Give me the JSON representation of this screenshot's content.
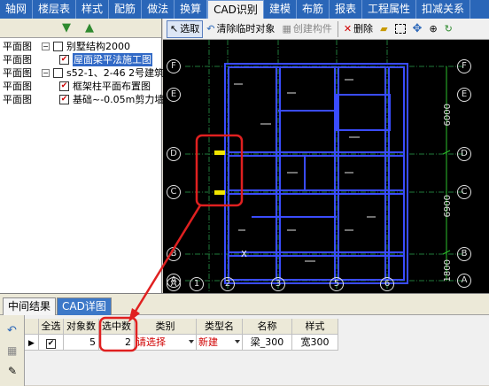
{
  "top_tabs": [
    "轴网",
    "楼层表",
    "样式",
    "配筋",
    "做法",
    "换算",
    "CAD识别",
    "建模",
    "布筋",
    "报表",
    "工程属性",
    "扣减关系"
  ],
  "active_tab_index": 6,
  "tree": [
    {
      "type": "平面图",
      "label": "别墅结构2000",
      "expander": "−",
      "checked": false,
      "indent": 1
    },
    {
      "type": "平面图",
      "label": "屋面梁平法施工图",
      "expander": "",
      "checked": true,
      "indent": 2,
      "selected": true
    },
    {
      "type": "平面图",
      "label": "s52-1、2-46 2号建筑",
      "expander": "−",
      "checked": false,
      "indent": 1
    },
    {
      "type": "平面图",
      "label": "框架柱平面布置图",
      "expander": "",
      "checked": true,
      "indent": 2
    },
    {
      "type": "平面图",
      "label": "基础~-0.05m剪力墙",
      "expander": "",
      "checked": true,
      "indent": 2
    }
  ],
  "toolbar": {
    "select": "选取",
    "clear_temp": "清除临时对象",
    "create_component": "创建构件",
    "delete": "删除"
  },
  "cad": {
    "row_axes": [
      "F",
      "E",
      "D",
      "C",
      "B",
      "A"
    ],
    "col_axes": [
      "A",
      "1",
      "2",
      "3",
      "5",
      "6"
    ],
    "dimensions": [
      "6000",
      "6900",
      "1800"
    ],
    "x_marker": "X"
  },
  "bottom": {
    "tabs": [
      "中间结果",
      "CAD详图"
    ],
    "columns": [
      "全选",
      "对象数",
      "选中数",
      "类别",
      "类型名",
      "名称",
      "样式"
    ],
    "rows": [
      {
        "checked": true,
        "object_count": "5",
        "selected_count": "2",
        "category": "请选择",
        "type_name": "新建",
        "name": "梁_300",
        "style": "宽300"
      }
    ]
  },
  "colors": {
    "tab_bar": "#2a66b8",
    "cad_background": "#000000",
    "cad_line": "#3a4cff",
    "annotation": "#e02020",
    "warning_text": "#d00000"
  }
}
